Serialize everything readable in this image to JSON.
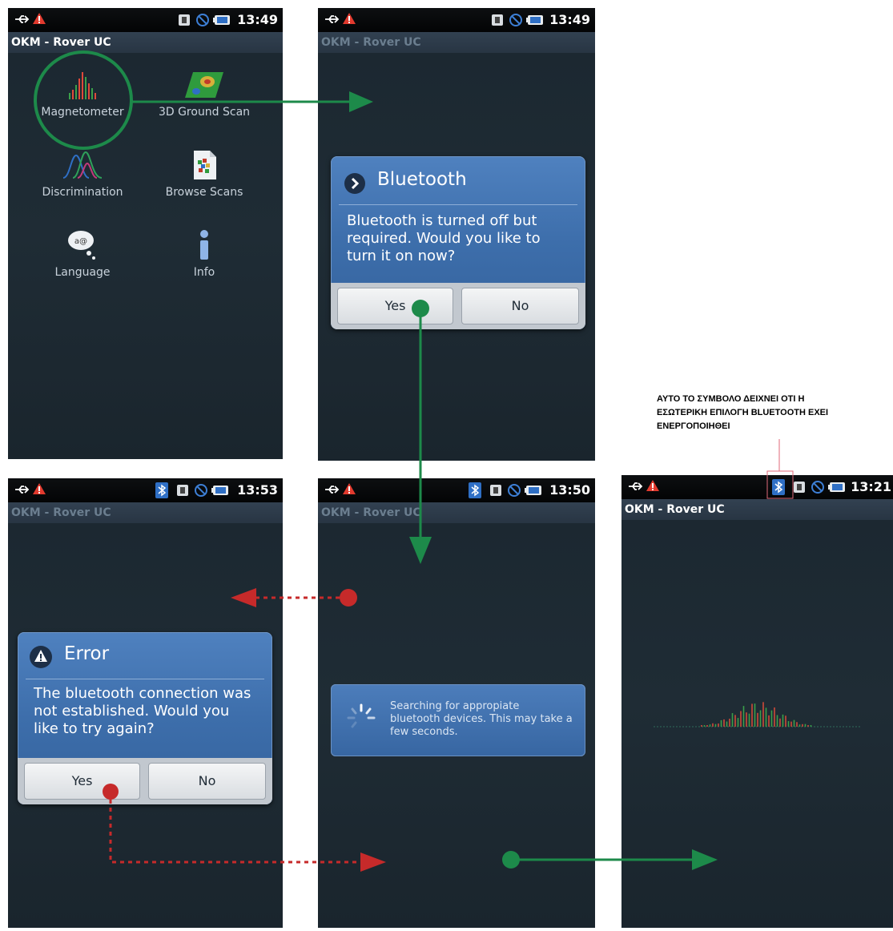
{
  "app_title": "OKM - Rover UC",
  "screens": {
    "launcher": {
      "time": "13:49",
      "items": [
        {
          "label": "Magnetometer"
        },
        {
          "label": "3D Ground Scan"
        },
        {
          "label": "Discrimination"
        },
        {
          "label": "Browse Scans"
        },
        {
          "label": "Language"
        },
        {
          "label": "Info"
        }
      ]
    },
    "bluetooth_prompt": {
      "time": "13:49",
      "dialog_title": "Bluetooth",
      "message_lines": [
        "Bluetooth is turned off but",
        "required. Would you like to",
        "turn it on now?"
      ],
      "yes": "Yes",
      "no": "No"
    },
    "error": {
      "time": "13:53",
      "dialog_title": "Error",
      "message_lines": [
        "The bluetooth connection was",
        "not established. Would you",
        "like to try again?"
      ],
      "yes": "Yes",
      "no": "No"
    },
    "searching": {
      "time": "13:50",
      "message_lines": [
        "Searching for appropiate",
        "bluetooth devices. This may take a",
        "few seconds."
      ]
    },
    "magnetometer": {
      "time": "13:21"
    }
  },
  "annotation_lines": [
    "ΑΥΤΟ ΤΟ ΣΥΜΒΟΛΟ ΔΕΙΧΝΕΙ ΟΤΙ Η",
    "ΕΣΩΤΕΡΙΚΗ ΕΠΙΛΟΓΗ BLUETOOTH ΕΧΕΙ",
    "ΕΝΕΡΓΟΠΟΙΗΘΕΙ"
  ],
  "colors": {
    "flow_green": "#1d8a4a",
    "flow_red": "#c62a2a",
    "dialog_blue": "#3d6eab",
    "titlebar": "#2e3c4a"
  }
}
